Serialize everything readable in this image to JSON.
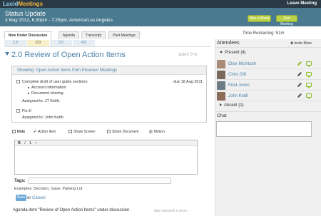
{
  "app": {
    "logo_part1": "Lucid",
    "logo_part2": "Meetings",
    "leave_label": "Leave Meeting"
  },
  "header": {
    "title": "Status Update",
    "datetime": "3 May 2012, 6:30pm - 7:25pm, America/Los Angeles",
    "take_break_label": "Take a Break",
    "end_meeting_label": "End Meeting"
  },
  "tabs": [
    {
      "label": "Now Under Discussion",
      "active": true
    },
    {
      "label": "Agenda",
      "active": false
    },
    {
      "label": "Transcript",
      "active": false
    },
    {
      "label": "Past Meetings",
      "active": false
    }
  ],
  "subtabs": [
    "1.0",
    "2.0",
    "3.0",
    "4.0"
  ],
  "active_subtab": "2.0",
  "timer": "Time Remaining: 51m",
  "agenda_item": {
    "title": "2.0 Review of Open Action Items",
    "spent": "spent 0 m"
  },
  "action_panel": {
    "heading": "Showing: Open Action Items from Previous Meetings",
    "items": [
      {
        "text": "Complete draft of user guide sections:",
        "due": "due 18 Aug 2011",
        "bullets": [
          "Account information",
          "Document sharing"
        ],
        "assigned": "Assigned to: JT Keith."
      },
      {
        "text": "Fix it!",
        "due": "",
        "bullets": [],
        "assigned": "Assigned to: John Keith."
      }
    ]
  },
  "toolbar": {
    "note": "Note",
    "action_item": "Action Item",
    "share_screen": "Share Screen",
    "share_document": "Share Document",
    "motion": "Motion"
  },
  "editor": {
    "bold": "B",
    "italic": "I",
    "ordered_list": "1.",
    "bullet_list": "•"
  },
  "tags": {
    "label": "Tags:",
    "examples": "Examples: Decision, Issue, Parking Lot"
  },
  "form": {
    "save": "Save",
    "or": "or",
    "cancel": "Cancel"
  },
  "status": {
    "text": "Agenda item \"Review of Open Action Items\" under discussion.",
    "meta": "Elise McIntosh 6:30 pm"
  },
  "sidebar": {
    "attendees_title": "Attendees",
    "invite_label": "Invite More",
    "present_label": "Present (4)",
    "absent_label": "Absent (1)",
    "attendees": [
      {
        "name": "Elise McIntosh",
        "avatar_color": "#a98b78"
      },
      {
        "name": "Chris Gift",
        "avatar_color": "#7a6a5e"
      },
      {
        "name": "Fred Jones",
        "avatar_color": "#6e7c86"
      },
      {
        "name": "John Keith",
        "avatar_color": "#8c6d5a"
      }
    ],
    "chat_label": "Chat"
  },
  "colors": {
    "header_bg": "#4a7a8f",
    "topbar_bg": "#2b3a45",
    "accent_green": "#b9d24a",
    "link_blue": "#4a80a8"
  }
}
